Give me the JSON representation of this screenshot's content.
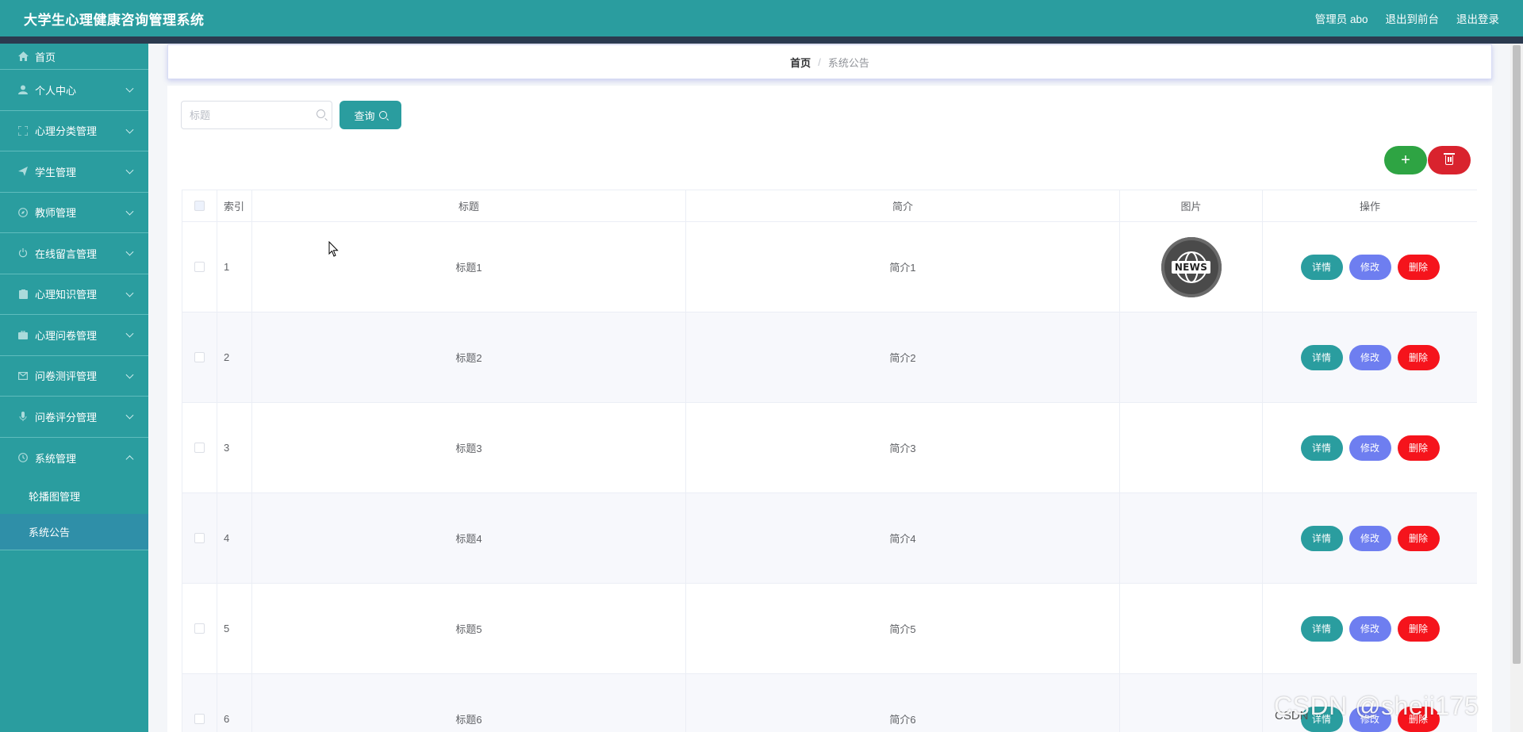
{
  "app": {
    "title": "大学生心理健康咨询管理系统",
    "user_label": "管理员 abo",
    "to_frontend": "退出到前台",
    "logout": "退出登录"
  },
  "sidebar": {
    "items": [
      {
        "label": "首页",
        "icon": "home-icon"
      },
      {
        "label": "个人中心",
        "icon": "user-icon"
      },
      {
        "label": "心理分类管理",
        "icon": "fullscreen-icon"
      },
      {
        "label": "学生管理",
        "icon": "send-icon"
      },
      {
        "label": "教师管理",
        "icon": "compass-icon"
      },
      {
        "label": "在线留言管理",
        "icon": "power-icon"
      },
      {
        "label": "心理知识管理",
        "icon": "document-icon"
      },
      {
        "label": "心理问卷管理",
        "icon": "suitcase-icon"
      },
      {
        "label": "问卷测评管理",
        "icon": "message-icon"
      },
      {
        "label": "问卷评分管理",
        "icon": "microphone-icon"
      },
      {
        "label": "系统管理",
        "icon": "time-icon"
      }
    ],
    "sub_items": [
      {
        "label": "轮播图管理"
      },
      {
        "label": "系统公告"
      }
    ],
    "active_sub": "系统公告"
  },
  "breadcrumb": {
    "home": "首页",
    "separator": "/",
    "current": "系统公告"
  },
  "search": {
    "placeholder": "标题",
    "value": "",
    "query_label": "查询"
  },
  "actions": {
    "add_label": "+",
    "delete_icon": "trash-icon"
  },
  "table": {
    "columns": [
      "索引",
      "标题",
      "简介",
      "图片",
      "操作"
    ],
    "rows": [
      {
        "index": "1",
        "title": "标题1",
        "intro": "简介1",
        "image_text": "NEWS"
      },
      {
        "index": "2",
        "title": "标题2",
        "intro": "简介2",
        "image_text": ""
      },
      {
        "index": "3",
        "title": "标题3",
        "intro": "简介3",
        "image_text": ""
      },
      {
        "index": "4",
        "title": "标题4",
        "intro": "简介4",
        "image_text": ""
      },
      {
        "index": "5",
        "title": "标题5",
        "intro": "简介5",
        "image_text": ""
      },
      {
        "index": "6",
        "title": "标题6",
        "intro": "简介6",
        "image_text": ""
      }
    ],
    "op_labels": {
      "detail": "详情",
      "edit": "修改",
      "delete": "删除"
    }
  },
  "watermark": "CSDN @sheji175",
  "watermark_small": "CSDN",
  "colors": {
    "primary": "#2a9d9f",
    "nav_strip": "#2b3a4f",
    "add_green": "#2ea443",
    "delete_red": "#d9232e",
    "edit_blue": "#6e7ef0",
    "op_delete_red": "#f5141c"
  }
}
